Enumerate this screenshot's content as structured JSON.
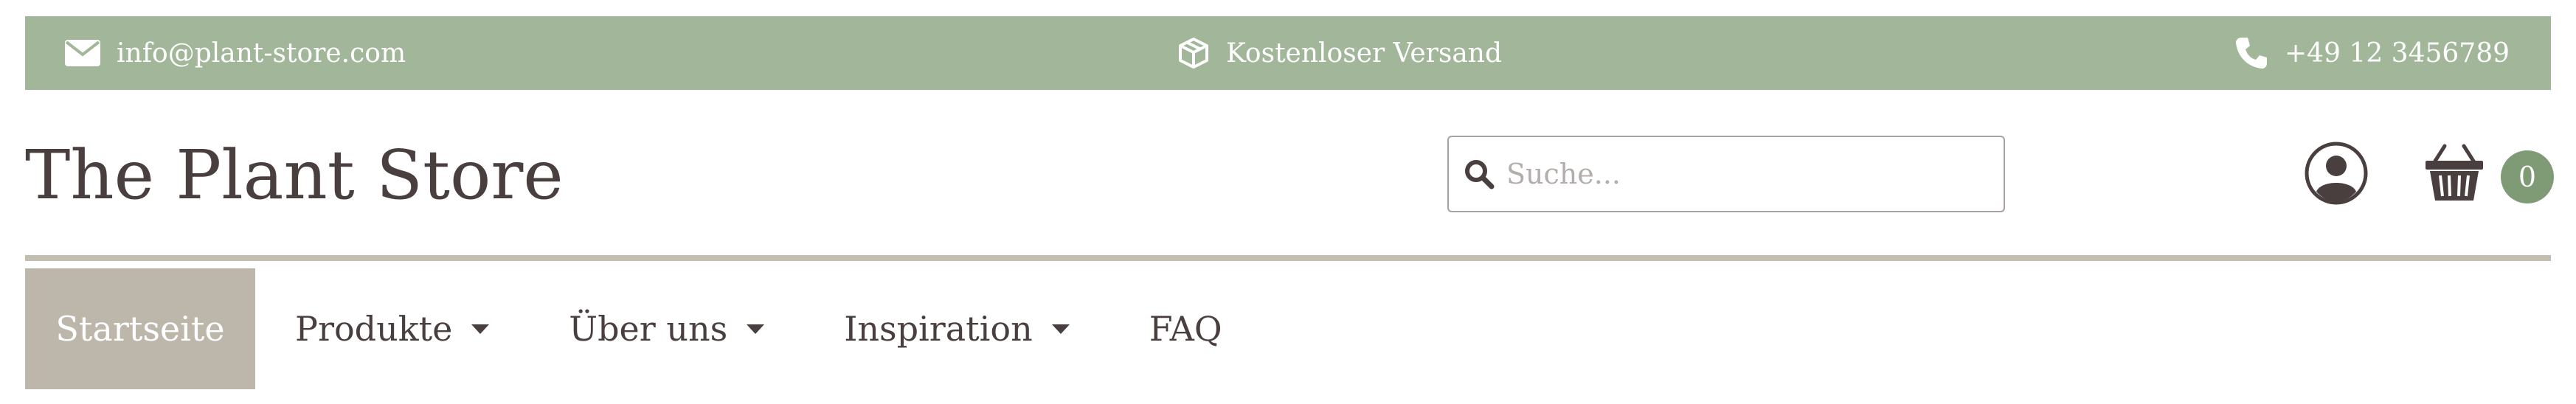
{
  "topbar": {
    "email": "info@plant-store.com",
    "shipping": "Kostenloser Versand",
    "phone": "+49 12 3456789",
    "icons": [
      "envelope-icon",
      "package-icon",
      "phone-icon"
    ]
  },
  "header": {
    "brand": "The Plant Store",
    "search": {
      "placeholder": "Suche...",
      "value": "",
      "icon": "search-icon"
    },
    "account_icon": "user-icon",
    "cart_icon": "basket-icon",
    "cart_count": "0"
  },
  "nav": {
    "items": [
      {
        "label": "Startseite",
        "active": true,
        "dropdown": false
      },
      {
        "label": "Produkte",
        "active": false,
        "dropdown": true
      },
      {
        "label": "Über uns",
        "active": false,
        "dropdown": true
      },
      {
        "label": "Inspiration",
        "active": false,
        "dropdown": true
      },
      {
        "label": "FAQ",
        "active": false,
        "dropdown": false
      }
    ]
  },
  "colors": {
    "topbar": "#a2b79a",
    "text": "#4a3f3f",
    "nav_active": "#bcb7aa",
    "divider": "#c3bdb0",
    "badge": "#7f9b76"
  }
}
